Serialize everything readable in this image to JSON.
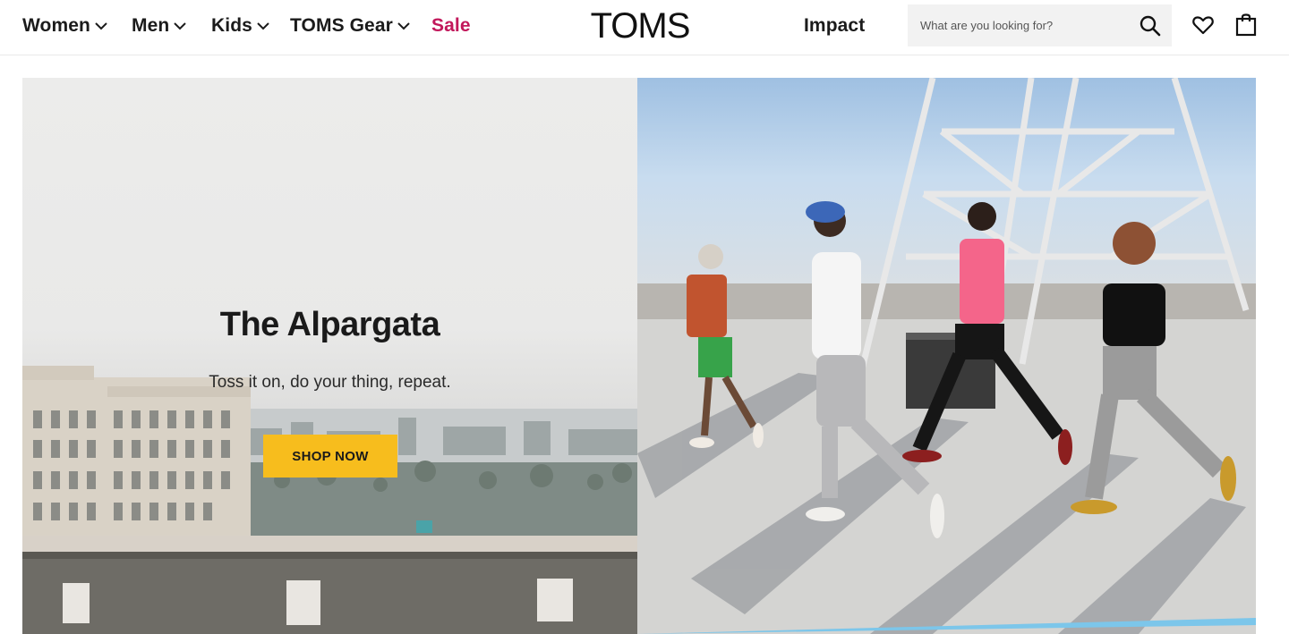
{
  "nav": {
    "women": "Women",
    "men": "Men",
    "kids": "Kids",
    "gear": "TOMS Gear",
    "sale": "Sale",
    "impact": "Impact"
  },
  "brand": {
    "logo": "TOMS"
  },
  "search": {
    "placeholder": "What are you looking for?",
    "value": ""
  },
  "icons": {
    "search": "search-icon",
    "wishlist": "heart-icon",
    "bag": "shopping-bag-icon",
    "chevron": "chevron-down-icon"
  },
  "hero": {
    "title": "The Alpargata",
    "subtitle": "Toss it on, do your thing, repeat.",
    "cta_label": "SHOP NOW"
  },
  "colors": {
    "sale": "#c2185b",
    "cta": "#f7bd1d",
    "search_bg": "#f2f2f2",
    "accent_stripe": "#7cc6ea"
  }
}
